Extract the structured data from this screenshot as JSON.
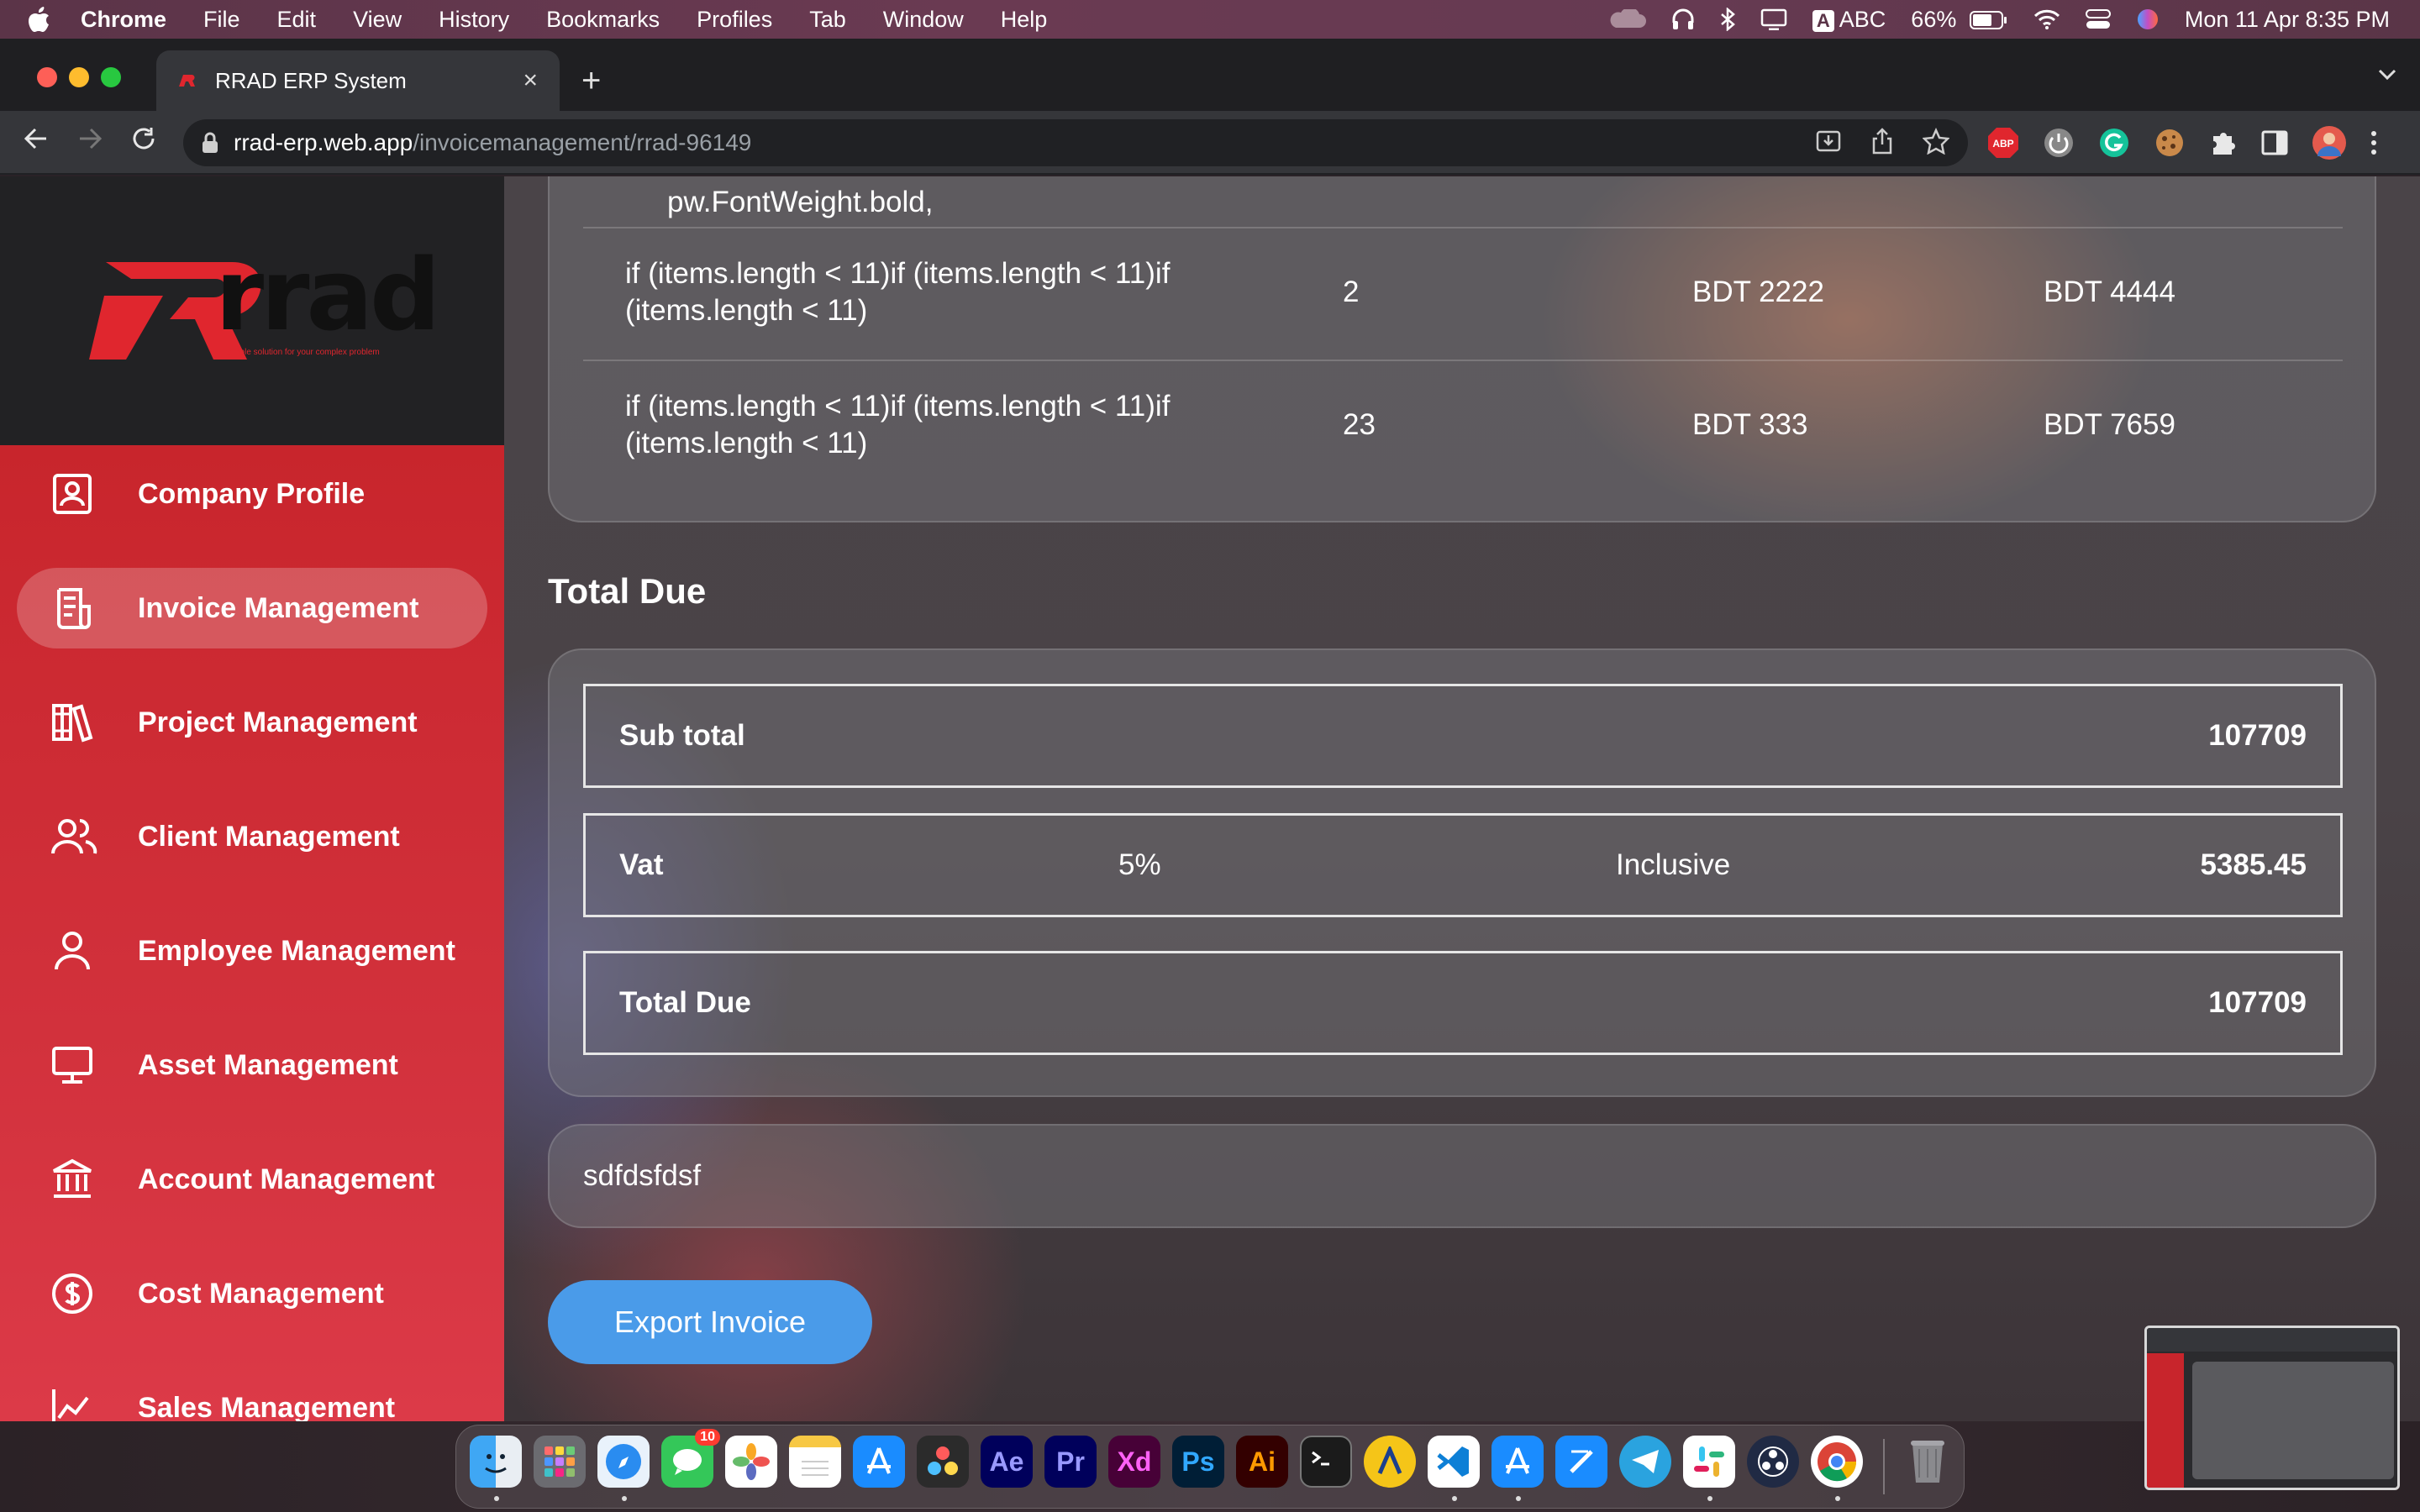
{
  "menubar": {
    "app": "Chrome",
    "items": [
      "File",
      "Edit",
      "View",
      "History",
      "Bookmarks",
      "Profiles",
      "Tab",
      "Window",
      "Help"
    ],
    "input_source": "ABC",
    "input_badge": "A",
    "battery": "66%",
    "datetime": "Mon 11 Apr  8:35 PM"
  },
  "browser": {
    "tab_title": "RRAD ERP System",
    "url_host": "rrad-erp.web.app",
    "url_path": "/invoicemanagement/rrad-96149",
    "abp_label": "ABP"
  },
  "logo": {
    "word": "rrad",
    "tagline": "simple solution for your complex problem"
  },
  "sidebar": {
    "items": [
      {
        "label": "Company Profile",
        "icon": "id-card-icon"
      },
      {
        "label": "Invoice Management",
        "icon": "invoice-icon",
        "active": true
      },
      {
        "label": "Project Management",
        "icon": "books-icon"
      },
      {
        "label": "Client Management",
        "icon": "users-icon"
      },
      {
        "label": "Employee Management",
        "icon": "user-icon"
      },
      {
        "label": "Asset Management",
        "icon": "monitor-icon"
      },
      {
        "label": "Account Management",
        "icon": "bank-icon"
      },
      {
        "label": "Cost Management",
        "icon": "dollar-circle-icon"
      },
      {
        "label": "Sales Management",
        "icon": "chart-icon"
      }
    ]
  },
  "items_table": {
    "partial_row": "pw.FontWeight.bold,",
    "rows": [
      {
        "description": "if (items.length < 11)if (items.length < 11)if (items.length < 11)",
        "quantity": "2",
        "rate": "BDT 2222",
        "amount": "BDT 4444"
      },
      {
        "description": "if (items.length < 11)if (items.length < 11)if (items.length < 11)",
        "quantity": "23",
        "rate": "BDT 333",
        "amount": "BDT 7659"
      }
    ]
  },
  "totals": {
    "heading": "Total Due",
    "subtotal_label": "Sub total",
    "subtotal_value": "107709",
    "vat_label": "Vat",
    "vat_rate": "5%",
    "vat_type": "Inclusive",
    "vat_value": "5385.45",
    "total_label": "Total Due",
    "total_value": "107709"
  },
  "note": "sdfdsfdsf",
  "export_button": "Export Invoice",
  "dock": {
    "messages_badge": "10",
    "ae": "Ae",
    "pr": "Pr",
    "xd": "Xd",
    "ps": "Ps",
    "ai": "Ai"
  },
  "colors": {
    "sidebar_red": "#d2313c",
    "export_blue": "#4a9be9",
    "logo_red": "#e0262e"
  }
}
